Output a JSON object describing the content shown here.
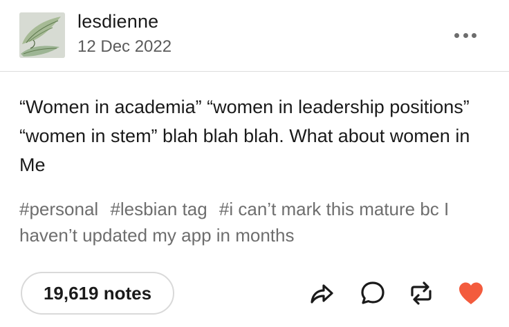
{
  "post": {
    "blog_name": "lesdienne",
    "date": "12 Dec 2022",
    "body": "“Women in academia” “women in leadership positions” “women in stem” blah blah blah. What about women in Me",
    "tags": [
      "#personal",
      "#lesbian tag",
      "#i can’t mark this mature bc I haven’t updated my app in months"
    ],
    "notes_label": "19,619 notes"
  },
  "icons": {
    "avatar": "wing-avatar",
    "more": "more-icon",
    "share": "share-icon",
    "reply": "reply-icon",
    "reblog": "reblog-icon",
    "like": "heart-icon"
  },
  "colors": {
    "like": "#f35b3d",
    "icon": "#1a1a1a",
    "tag_text": "#6e6e6e",
    "date_text": "#5b5b5b"
  }
}
